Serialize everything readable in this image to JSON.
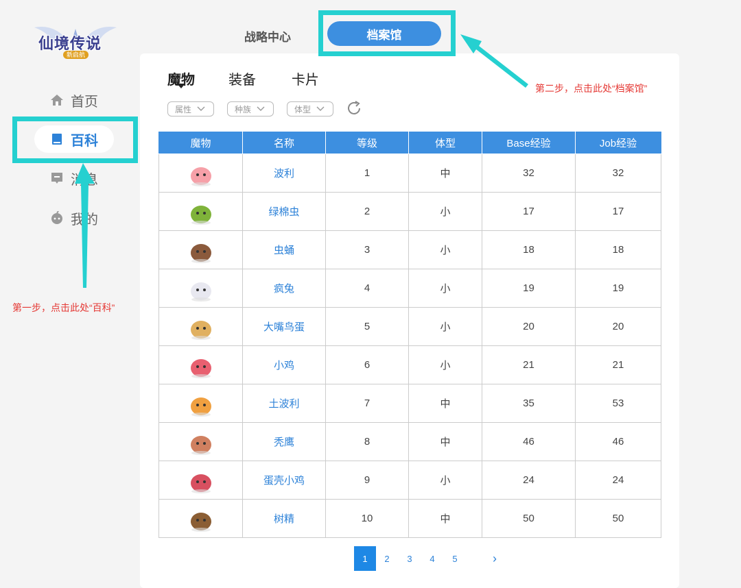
{
  "logo": {
    "text": "仙境传说",
    "sub": "新启航"
  },
  "sidebar": {
    "items": [
      {
        "label": "首页",
        "icon": "home-icon"
      },
      {
        "label": "百科",
        "icon": "book-icon",
        "active": true
      },
      {
        "label": "消息",
        "icon": "message-icon"
      },
      {
        "label": "我的",
        "icon": "user-icon"
      }
    ]
  },
  "top_tabs": [
    {
      "label": "战略中心"
    },
    {
      "label": "档案馆",
      "active": true
    }
  ],
  "sub_tabs": [
    {
      "label": "魔物",
      "active": true
    },
    {
      "label": "装备"
    },
    {
      "label": "卡片"
    }
  ],
  "filters": [
    {
      "label": "属性"
    },
    {
      "label": "种族"
    },
    {
      "label": "体型"
    }
  ],
  "table": {
    "headers": [
      "魔物",
      "名称",
      "等级",
      "体型",
      "Base经验",
      "Job经验"
    ],
    "rows": [
      {
        "name": "波利",
        "level": "1",
        "size": "中",
        "base": "32",
        "job": "32",
        "color": "#f6a0a8"
      },
      {
        "name": "绿棉虫",
        "level": "2",
        "size": "小",
        "base": "17",
        "job": "17",
        "color": "#7fb33a"
      },
      {
        "name": "虫蛹",
        "level": "3",
        "size": "小",
        "base": "18",
        "job": "18",
        "color": "#8b5a3c"
      },
      {
        "name": "疯兔",
        "level": "4",
        "size": "小",
        "base": "19",
        "job": "19",
        "color": "#e8e8f0"
      },
      {
        "name": "大嘴鸟蛋",
        "level": "5",
        "size": "小",
        "base": "20",
        "job": "20",
        "color": "#e0b060"
      },
      {
        "name": "小鸡",
        "level": "6",
        "size": "小",
        "base": "21",
        "job": "21",
        "color": "#e86070"
      },
      {
        "name": "土波利",
        "level": "7",
        "size": "中",
        "base": "35",
        "job": "53",
        "color": "#f0a040"
      },
      {
        "name": "秃鹰",
        "level": "8",
        "size": "中",
        "base": "46",
        "job": "46",
        "color": "#d08060"
      },
      {
        "name": "蛋壳小鸡",
        "level": "9",
        "size": "小",
        "base": "24",
        "job": "24",
        "color": "#d85060"
      },
      {
        "name": "树精",
        "level": "10",
        "size": "中",
        "base": "50",
        "job": "50",
        "color": "#8b5e34"
      }
    ]
  },
  "pagination": {
    "pages": [
      "1",
      "2",
      "3",
      "4",
      "5"
    ],
    "current": "1",
    "next": "›"
  },
  "annotations": {
    "step1": "第一步，点击此处“百科”",
    "step2": "第二步，点击此处“档案馆”",
    "highlight_color": "#25d0d0"
  }
}
